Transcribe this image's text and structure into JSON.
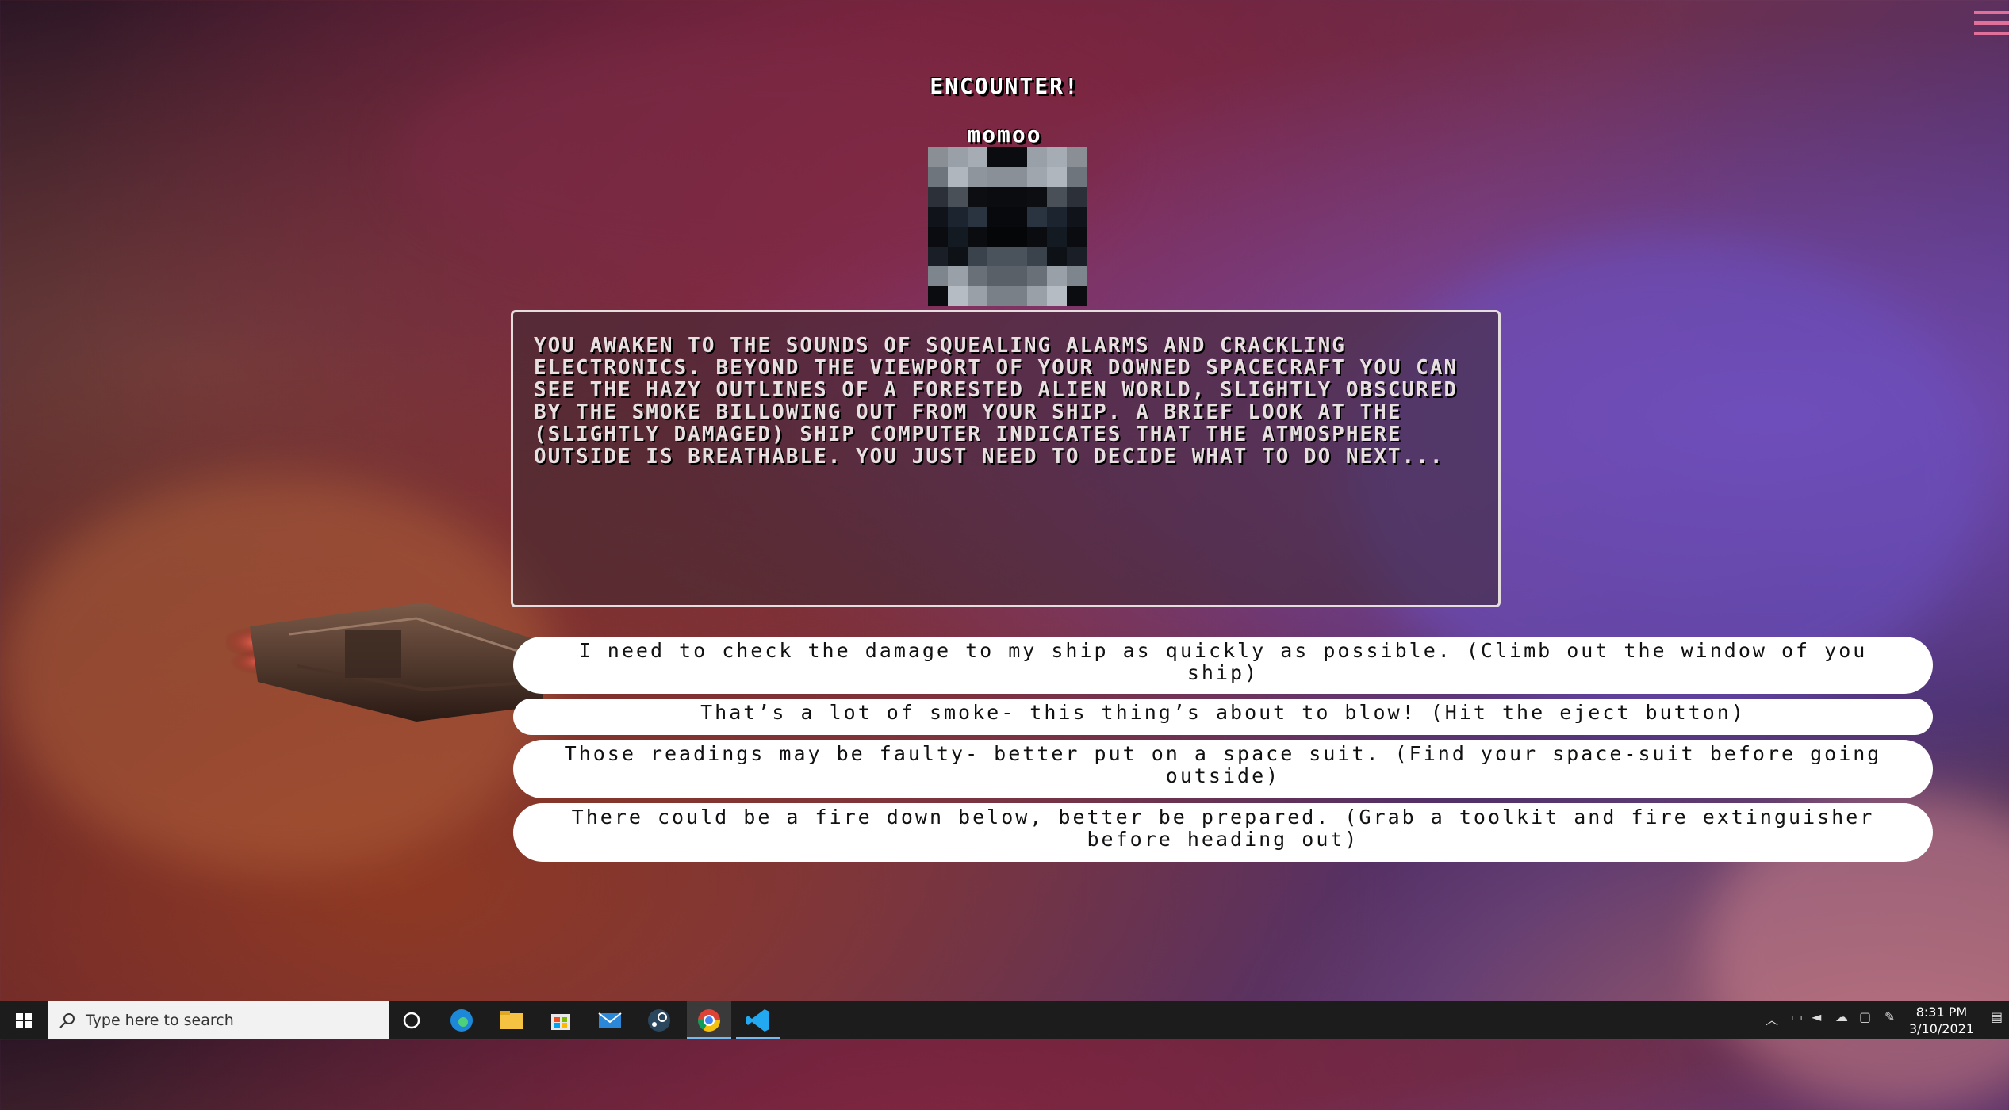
{
  "encounter": {
    "heading": "ENCOUNTER!",
    "enemy_name": "momoo",
    "story": "YOU AWAKEN TO THE SOUNDS OF SQUEALING ALARMS AND CRACKLING ELECTRONICS. BEYOND THE VIEWPORT OF YOUR DOWNED SPACECRAFT YOU CAN SEE THE HAZY OUTLINES OF A FORESTED ALIEN WORLD, SLIGHTLY OBSCURED BY THE SMOKE BILLOWING OUT FROM YOUR SHIP. A BRIEF LOOK AT THE (SLIGHTLY DAMAGED) SHIP COMPUTER INDICATES THAT THE ATMOSPHERE OUTSIDE IS BREATHABLE. YOU JUST NEED TO DECIDE WHAT TO DO NEXT..."
  },
  "choices": [
    "I need to check the damage to my ship as quickly as possible. (Climb out the window of you ship)",
    "That’s a lot of smoke- this thing’s about to blow! (Hit the eject button)",
    "Those readings may be faulty- better put on a space suit. (Find your space-suit before going outside)",
    "There could be a fire down below, better be prepared. (Grab a toolkit and fire extinguisher before heading out)"
  ],
  "colors": {
    "menu_accent": "#e0709a",
    "choice_bg": "#ffffff",
    "story_border": "#e6dede"
  },
  "portrait_pixels": [
    [
      "#8a8f96",
      "#9aa0a8",
      "#a6acb4",
      "#0a0c10",
      "#0a0c10",
      "#9aa0a8",
      "#a6acb4",
      "#8a8f96"
    ],
    [
      "#6f757c",
      "#b0b6be",
      "#8f959c",
      "#8a9098",
      "#8a9098",
      "#a0a6ae",
      "#b0b6be",
      "#6f757c"
    ],
    [
      "#2c3038",
      "#4a5058",
      "#0c0e12",
      "#0a0c10",
      "#0a0c10",
      "#0c0e12",
      "#4a5058",
      "#2c3038"
    ],
    [
      "#10131a",
      "#1c2430",
      "#2a3440",
      "#08090c",
      "#08090c",
      "#2a3440",
      "#1c2430",
      "#10131a"
    ],
    [
      "#0a0c10",
      "#141a22",
      "#0a0c10",
      "#050608",
      "#050608",
      "#0a0c10",
      "#141a22",
      "#0a0c10"
    ],
    [
      "#1a1e26",
      "#0e1116",
      "#3a424c",
      "#4a525c",
      "#4a525c",
      "#3a424c",
      "#0e1116",
      "#1a1e26"
    ],
    [
      "#7f858c",
      "#9aa0a8",
      "#6a7078",
      "#5a6068",
      "#5a6068",
      "#6a7078",
      "#9aa0a8",
      "#7f858c"
    ],
    [
      "#0a0c10",
      "#b6bcc4",
      "#9aa0a8",
      "#7a8088",
      "#7a8088",
      "#9aa0a8",
      "#b6bcc4",
      "#0a0c10"
    ]
  ],
  "taskbar": {
    "search_placeholder": "Type here to search",
    "time": "8:31 PM",
    "date": "3/10/2021"
  }
}
